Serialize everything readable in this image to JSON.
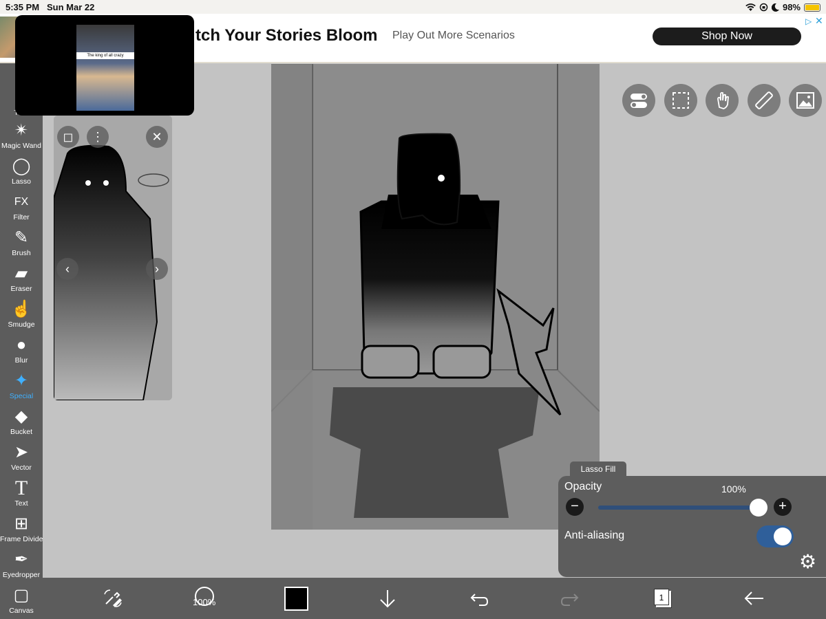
{
  "status_bar": {
    "time": "5:35 PM",
    "date": "Sun Mar 22",
    "battery": "98%",
    "battery_level": 0.98
  },
  "ad": {
    "headline": "tch Your Stories Bloom",
    "subline": "Play Out More Scenarios",
    "cta": "Shop Now",
    "adchoices_icon": "adchoices-icon",
    "close_icon": "close-icon"
  },
  "pip": {
    "caption": "The king of all crazy"
  },
  "tools": [
    {
      "label": "Tran",
      "icon": "transform-icon"
    },
    {
      "label": "Magic Wand",
      "icon": "magic-wand-icon"
    },
    {
      "label": "Lasso",
      "icon": "lasso-icon"
    },
    {
      "label": "Filter",
      "icon": "fx-icon"
    },
    {
      "label": "Brush",
      "icon": "brush-icon"
    },
    {
      "label": "Eraser",
      "icon": "eraser-icon"
    },
    {
      "label": "Smudge",
      "icon": "smudge-icon"
    },
    {
      "label": "Blur",
      "icon": "blur-icon"
    },
    {
      "label": "Special",
      "icon": "special-icon"
    },
    {
      "label": "Bucket",
      "icon": "bucket-icon"
    },
    {
      "label": "Vector",
      "icon": "vector-icon"
    },
    {
      "label": "Text",
      "icon": "text-icon"
    },
    {
      "label": "Frame Divider",
      "icon": "frame-divider-icon"
    },
    {
      "label": "Eyedropper",
      "icon": "eyedropper-icon"
    },
    {
      "label": "Canvas",
      "icon": "canvas-icon"
    }
  ],
  "active_tool": "Special",
  "fx_glyph": "FX",
  "text_glyph": "T",
  "lasso_fill": {
    "tab": "Lasso Fill",
    "opacity_label": "Opacity",
    "opacity_value": "100%",
    "opacity_fraction": 1.0,
    "minus": "−",
    "plus": "+",
    "antialias_label": "Anti-aliasing",
    "antialias_on": true
  },
  "bottom_bar": {
    "brush_size": "100%",
    "layer_count": "1",
    "color": "#000000"
  },
  "colors": {
    "toolbar": "#5c5c5c",
    "accent": "#3fb0ff",
    "panel": "#5d5d5d"
  }
}
